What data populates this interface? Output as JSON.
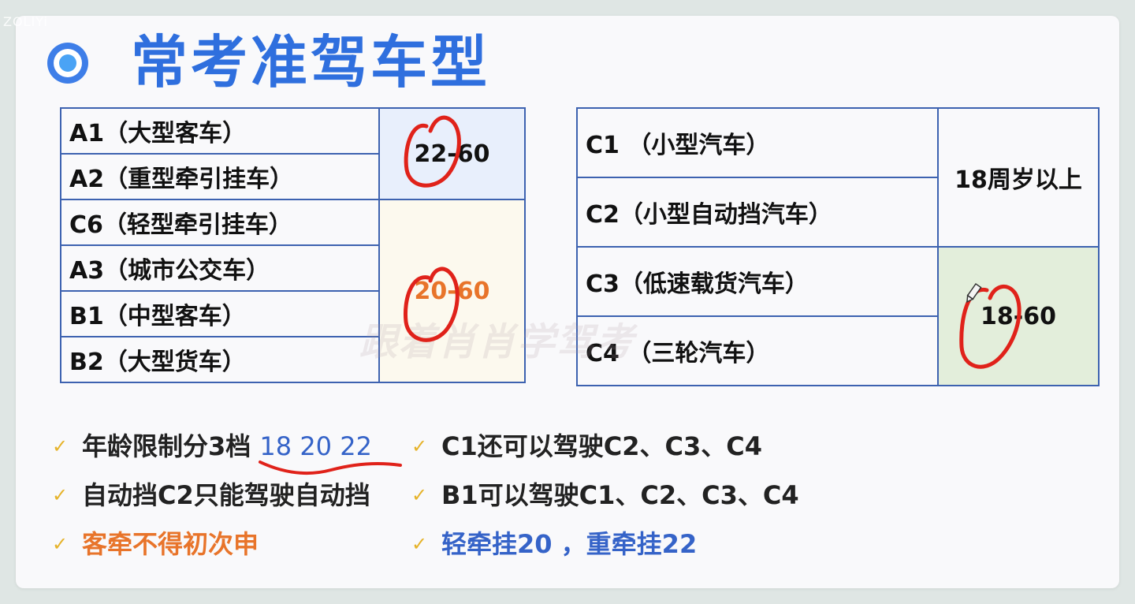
{
  "watermark_top": "ZOLIYi",
  "title": "常考准驾车型",
  "left_table": {
    "groups": [
      {
        "age": "22-60",
        "rows": [
          "A1（大型客车）",
          "A2（重型牵引挂车）"
        ]
      },
      {
        "age": "20-60",
        "rows": [
          "C6（轻型牵引挂车）",
          "A3（城市公交车）",
          "B1（中型客车）",
          "B2（大型货车）"
        ]
      }
    ]
  },
  "right_table": {
    "groups": [
      {
        "age": "18周岁以上",
        "rows": [
          "C1 （小型汽车）",
          "C2（小型自动挡汽车）"
        ]
      },
      {
        "age": "18-60",
        "rows": [
          "C3（低速载货汽车）",
          "C4 （三轮汽车）"
        ]
      }
    ]
  },
  "watermark_center": "跟着肖肖学驾考",
  "notes_left": [
    {
      "prefix": "年龄限制分3档 ",
      "highlight": "18 20 22"
    },
    {
      "text": "自动挡C2只能驾驶自动挡"
    },
    {
      "text": "客牵不得初次申"
    }
  ],
  "notes_right": [
    {
      "text": "C1还可以驾驶C2、C3、C4"
    },
    {
      "text": "B1可以驾驶C1、C2、C3、C4"
    },
    {
      "text": "轻牵挂20 ，重牵挂22"
    }
  ],
  "colors": {
    "title": "#2f6fde",
    "table_border": "#3d62b0",
    "cell_blue": "#e8effc",
    "cell_cream": "#fcf9ee",
    "cell_green": "#e3eedb",
    "orange": "#e8742a",
    "blue_text": "#3563c8",
    "check": "#e6b32a",
    "ink_red": "#e0221a"
  },
  "icons": {
    "title_bullet": "target-dot-icon",
    "check": "check-icon",
    "pencil": "pencil-cursor-icon"
  }
}
